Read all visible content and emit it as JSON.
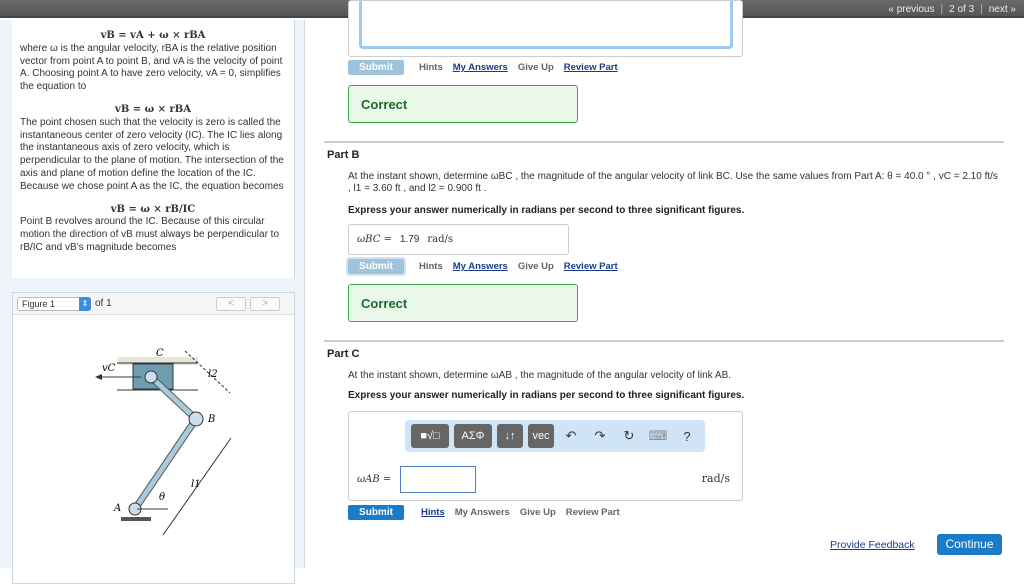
{
  "topnav": {
    "previous": "« previous",
    "page": "2 of 3",
    "next": "next »"
  },
  "explanation": {
    "eq1": "vB = vA + ω × rBA",
    "p1": "where ω is the angular velocity, rBA is the relative position vector from point A to point B, and vA is the velocity of point A. Choosing point A to have zero velocity, vA = 0, simplifies the equation to",
    "eq2": "vB = ω × rBA",
    "p2": "The point chosen such that the velocity is zero is called the instantaneous center of zero velocity (IC). The IC lies along the instantaneous axis of zero velocity, which is perpendicular to the plane of motion. The intersection of the axis and plane of motion define the location of the IC. Because we chose point A as the IC, the equation becomes",
    "eq3": "vB = ω × rB/IC",
    "p3": "Point B revolves around the IC. Because of this circular motion the direction of vB must always be perpendicular to rB/IC and vB's magnitude becomes"
  },
  "figure": {
    "select": "Figure 1",
    "of": "of 1",
    "prev": "<",
    "next": ">",
    "labels": {
      "vc": "vC",
      "c": "C",
      "b": "B",
      "a": "A",
      "theta": "θ",
      "l1": "l1",
      "l2": "l2"
    }
  },
  "partA": {
    "submit": "Submit",
    "hints": "Hints",
    "my_answers": "My Answers",
    "give_up": "Give Up",
    "review": "Review Part",
    "result": "Correct"
  },
  "partB": {
    "title": "Part B",
    "question": "At the instant shown, determine ωBC , the magnitude of the angular velocity of link BC. Use the same values from Part A: θ = 40.0 ° , vC = 2.10 ft/s , l1 = 3.60 ft , and l2 = 0.900 ft .",
    "instruction": "Express your answer numerically in radians per second to three significant figures.",
    "var": "ωBC =",
    "value": "1.79",
    "unit": "rad/s",
    "submit": "Submit",
    "hints": "Hints",
    "my_answers": "My Answers",
    "give_up": "Give Up",
    "review": "Review Part",
    "result": "Correct"
  },
  "partC": {
    "title": "Part C",
    "question": "At the instant shown, determine ωAB , the magnitude of the angular velocity of link AB.",
    "instruction": "Express your answer numerically in radians per second to three significant figures.",
    "toolbar": {
      "templates": "■√□",
      "greek": "ΑΣΦ",
      "arrows": "↓↑",
      "vec": "vec",
      "undo": "↶",
      "redo": "↷",
      "reset": "↻",
      "keyboard": "⌨",
      "help": "?"
    },
    "var": "ωAB =",
    "value": "",
    "unit": "rad/s",
    "submit": "Submit",
    "hints": "Hints",
    "my_answers": "My Answers",
    "give_up": "Give Up",
    "review": "Review Part"
  },
  "footer": {
    "feedback": "Provide Feedback",
    "continue": "Continue"
  }
}
